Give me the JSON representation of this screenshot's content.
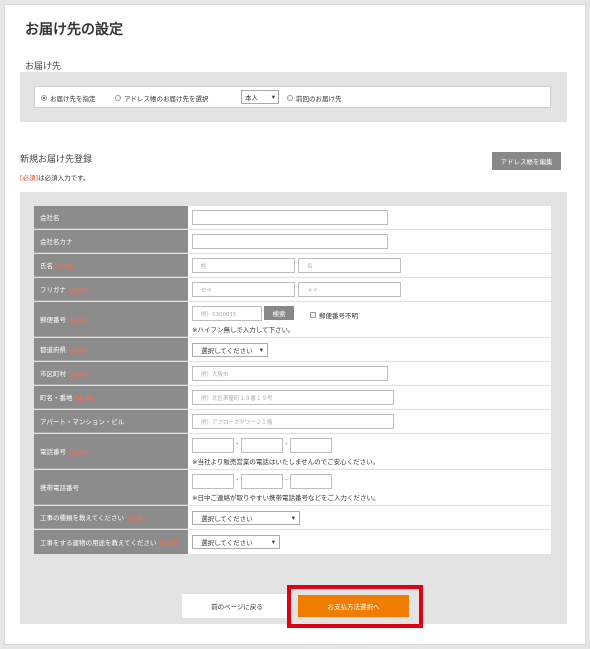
{
  "page": {
    "title": "お届け先の設定"
  },
  "destination": {
    "section_title": "お届け先",
    "options": [
      {
        "label": "お届け先を指定",
        "selected": true
      },
      {
        "label": "アドレス帳のお届け先を選択",
        "selected": false
      },
      {
        "label": "前回のお届け先",
        "selected": false
      }
    ],
    "address_book_select": "本人"
  },
  "registration": {
    "section_title": "新規お届け先登録",
    "required_tag": "[必須]",
    "required_note": "は必須入力です。",
    "address_book_button": "アドレス帳を編集"
  },
  "form": {
    "required_mark": "[必須]",
    "company_name": {
      "label": "会社名",
      "value": ""
    },
    "company_kana": {
      "label": "会社名カナ",
      "value": ""
    },
    "name": {
      "label": "氏名",
      "last_placeholder": "姓",
      "first_placeholder": "名"
    },
    "furigana": {
      "label": "フリガナ",
      "last_placeholder": "セイ",
      "first_placeholder": "メイ"
    },
    "postal": {
      "label": "郵便番号",
      "placeholder": "例）5300015",
      "search_button": "検索",
      "unknown_label": "郵便番号不明",
      "note": "※ハイフン無しで入力して下さい。"
    },
    "prefecture": {
      "label": "都道府県",
      "selected": "選択してください"
    },
    "city": {
      "label": "市区町村",
      "placeholder": "例）大阪市"
    },
    "street": {
      "label": "町名・番地",
      "placeholder": "例）北区茶屋町１９番１９号"
    },
    "building": {
      "label": "アパート・マンション・ビル",
      "placeholder": "例）アプローズタワー２１階"
    },
    "phone": {
      "label": "電話番号",
      "separator": "-",
      "note": "※当社より販売営業の電話はいたしませんのでご安心ください。"
    },
    "mobile": {
      "label": "携帯電話番号",
      "separator": "-",
      "note": "※日中ご連絡が取りやすい携帯電話番号などをご入力ください。"
    },
    "work_type": {
      "label": "工事の種類を教えてください",
      "selected": "選択してください"
    },
    "building_use": {
      "label": "工事をする建物の用途を教えてください",
      "selected": "選択してください"
    }
  },
  "actions": {
    "back_label": "前のページに戻る",
    "next_label": "お支払方法選択へ"
  },
  "colors": {
    "accent": "#f07c00",
    "highlight": "#e00012",
    "required": "#e0402a",
    "label_bg": "#8c8c8c"
  }
}
